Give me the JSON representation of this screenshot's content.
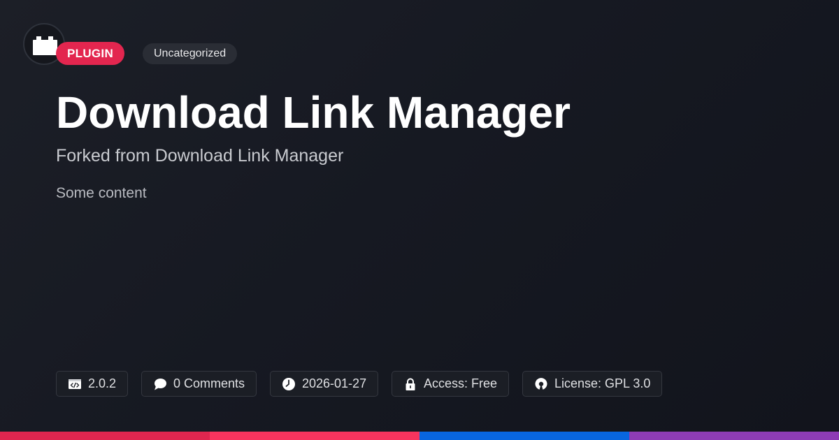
{
  "badges": {
    "type": "PLUGIN",
    "category": "Uncategorized"
  },
  "title": "Download Link Manager",
  "subtitle": "Forked from Download Link Manager",
  "content": "Some content",
  "meta": {
    "version": "2.0.2",
    "comments": "0 Comments",
    "date": "2026-01-27",
    "access": "Access: Free",
    "license": "License: GPL 3.0"
  },
  "icons": [
    "plugin-block-icon",
    "code-icon",
    "comment-icon",
    "clock-icon",
    "lock-icon",
    "open-source-icon"
  ],
  "colors": {
    "background": "#161922",
    "plugin_badge": "#e3264f",
    "category_badge": "#2a2d35",
    "bottom_bar": [
      "#e0264f",
      "#f7345e",
      "#0866e0",
      "#8e3cb5"
    ]
  }
}
